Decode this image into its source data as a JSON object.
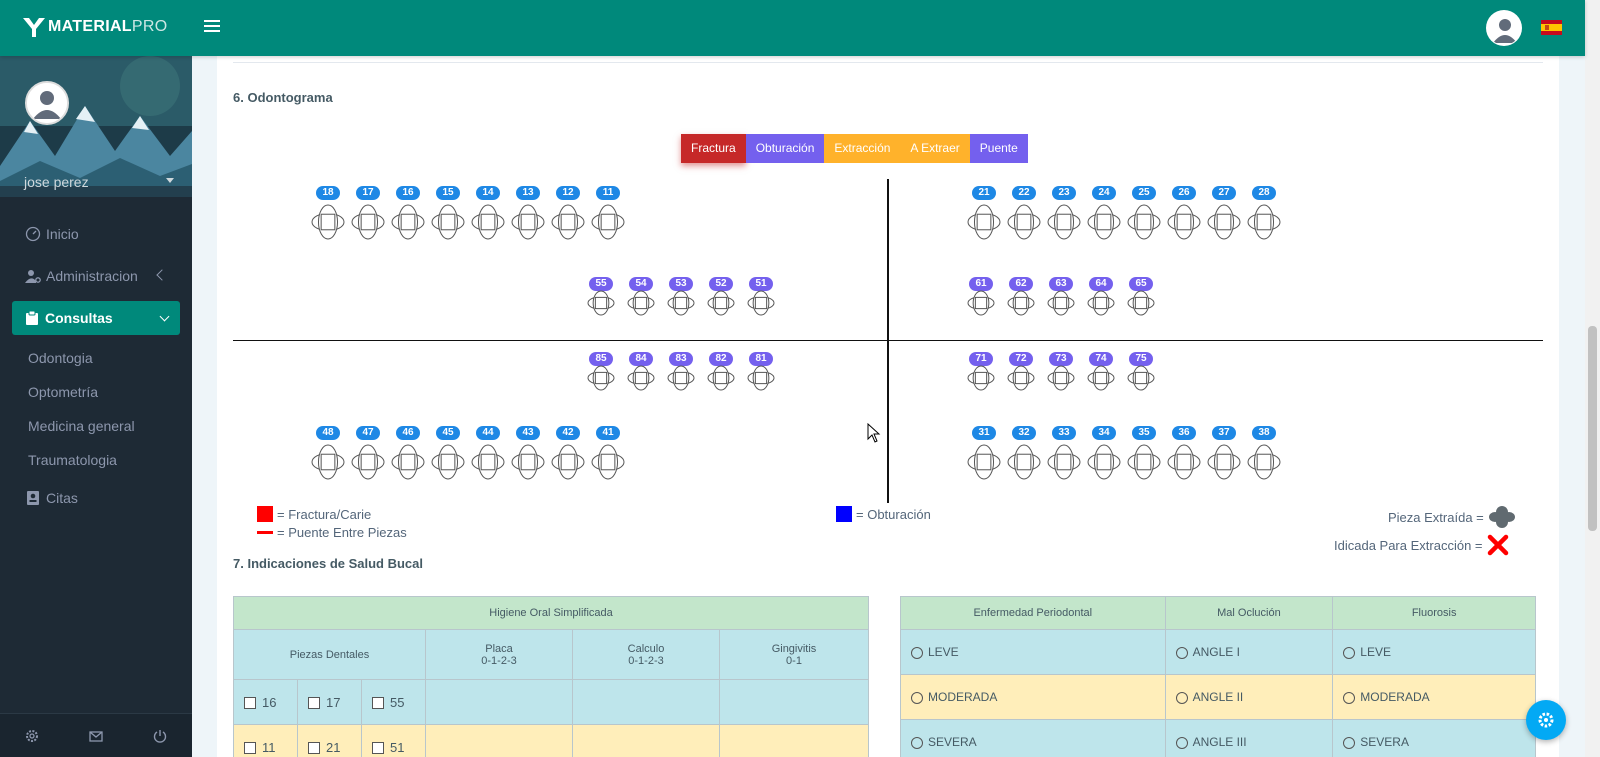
{
  "brand": {
    "bold": "MATERIAL",
    "light": "PRO"
  },
  "topbar": {
    "menu_icon": "hamburger-icon",
    "avatar_icon": "user-avatar",
    "flag_icon": "spain-flag-icon"
  },
  "sidebar": {
    "user_name": "jose perez",
    "items": [
      {
        "label": "Inicio",
        "icon": "gauge-icon"
      },
      {
        "label": "Administracion",
        "icon": "user-gear-icon"
      },
      {
        "label": "Consultas",
        "icon": "clipboard-icon"
      }
    ],
    "subitems": [
      "Odontogia",
      "Optometría",
      "Medicina general",
      "Traumatologia"
    ],
    "citas": "Citas",
    "footer_icons": [
      "settings-icon",
      "mail-icon",
      "power-icon"
    ]
  },
  "section6": {
    "title": "6. Odontograma",
    "buttons": [
      {
        "label": "Fractura",
        "color": "#c62828"
      },
      {
        "label": "Obturación",
        "color": "#7460ee"
      },
      {
        "label": "Extracción",
        "color": "#ffb22b"
      },
      {
        "label": "A Extraer",
        "color": "#ffb22b"
      },
      {
        "label": "Puente",
        "color": "#7460ee"
      }
    ],
    "teeth": {
      "upper_right": [
        "18",
        "17",
        "16",
        "15",
        "14",
        "13",
        "12",
        "11"
      ],
      "upper_left": [
        "21",
        "22",
        "23",
        "24",
        "25",
        "26",
        "27",
        "28"
      ],
      "deciduous_upper_right": [
        "55",
        "54",
        "53",
        "52",
        "51"
      ],
      "deciduous_upper_left": [
        "61",
        "62",
        "63",
        "64",
        "65"
      ],
      "deciduous_lower_right": [
        "85",
        "84",
        "83",
        "82",
        "81"
      ],
      "deciduous_lower_left": [
        "71",
        "72",
        "73",
        "74",
        "75"
      ],
      "lower_right": [
        "48",
        "47",
        "46",
        "45",
        "44",
        "43",
        "42",
        "41"
      ],
      "lower_left": [
        "31",
        "32",
        "33",
        "34",
        "35",
        "36",
        "37",
        "38"
      ]
    },
    "legend": {
      "fractura": "= Fractura/Carie",
      "puente": "= Puente Entre Piezas",
      "obturacion": "= Obturación",
      "extraida": "Pieza Extraída =",
      "indicada": "Idicada Para Extracción ="
    },
    "colors": {
      "permanent_badge": "#1e88e5",
      "deciduous_badge": "#7460ee",
      "red": "#ff0000",
      "blue": "#0000ff"
    }
  },
  "section7": {
    "title": "7. Indicaciones de Salud Bucal",
    "higiene": {
      "title": "Higiene Oral Simplificada",
      "col_piezas": "Piezas Dentales",
      "col_placa": "Placa",
      "col_placa_scale": "0-1-2-3",
      "col_calculo": "Calculo",
      "col_calculo_scale": "0-1-2-3",
      "col_gingivitis": "Gingivitis",
      "col_gingivitis_scale": "0-1",
      "row1": [
        "16",
        "17",
        "55"
      ],
      "row2": [
        "11",
        "21",
        "51"
      ]
    },
    "enfermedad": {
      "col1": "Enfermedad Periodontal",
      "col2": "Mal Oclución",
      "col3": "Fluorosis",
      "rows": [
        [
          "LEVE",
          "ANGLE I",
          "LEVE"
        ],
        [
          "MODERADA",
          "ANGLE II",
          "MODERADA"
        ],
        [
          "SEVERA",
          "ANGLE III",
          "SEVERA"
        ]
      ]
    }
  }
}
